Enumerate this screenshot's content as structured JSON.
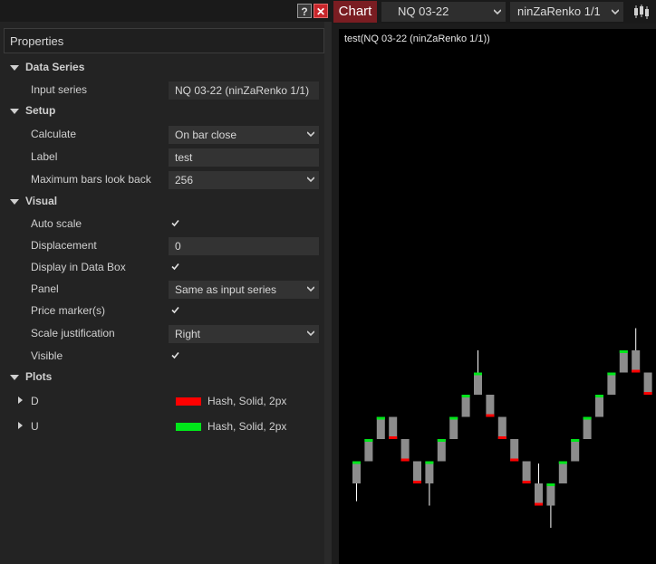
{
  "window": {
    "help_label": "?",
    "close_label": "✕"
  },
  "properties": {
    "title": "Properties",
    "categories": [
      {
        "name": "Data Series"
      },
      {
        "name": "Setup"
      },
      {
        "name": "Visual"
      },
      {
        "name": "Plots"
      }
    ],
    "data_series": {
      "input_series_label": "Input series",
      "input_series_value": "NQ 03-22 (ninZaRenko 1/1)"
    },
    "setup": {
      "calculate_label": "Calculate",
      "calculate_value": "On bar close",
      "label_label": "Label",
      "label_value": "test",
      "max_bars_label": "Maximum bars look back",
      "max_bars_value": "256"
    },
    "visual": {
      "auto_scale_label": "Auto scale",
      "auto_scale_checked": true,
      "displacement_label": "Displacement",
      "displacement_value": "0",
      "data_box_label": "Display in Data Box",
      "data_box_checked": true,
      "panel_label": "Panel",
      "panel_value": "Same as input series",
      "price_marker_label": "Price marker(s)",
      "price_marker_checked": true,
      "scale_just_label": "Scale justification",
      "scale_just_value": "Right",
      "visible_label": "Visible",
      "visible_checked": true
    },
    "plots": [
      {
        "name": "D",
        "color": "#ff0000",
        "desc": "Hash, Solid, 2px"
      },
      {
        "name": "U",
        "color": "#00e61a",
        "desc": "Hash, Solid, 2px"
      }
    ]
  },
  "chart_toolbar": {
    "tab_label": "Chart",
    "instrument": "NQ 03-22",
    "bar_type": "ninZaRenko 1/1"
  },
  "chart": {
    "label": "test(NQ 03-22 (ninZaRenko 1/1))",
    "colors": {
      "body": "#8c8c8c",
      "up_marker": "#00e61a",
      "down_marker": "#ff0000",
      "wick": "#ffffff",
      "background": "#000000"
    },
    "bars": [
      {
        "dir": "up",
        "low": 15,
        "high": 16,
        "wick_low": 14.2
      },
      {
        "dir": "up",
        "low": 16,
        "high": 17
      },
      {
        "dir": "up",
        "low": 17,
        "high": 18
      },
      {
        "dir": "down",
        "low": 17,
        "high": 18
      },
      {
        "dir": "down",
        "low": 16,
        "high": 17
      },
      {
        "dir": "down",
        "low": 15,
        "high": 16
      },
      {
        "dir": "up",
        "low": 15,
        "high": 16,
        "wick_low": 14.0
      },
      {
        "dir": "up",
        "low": 16,
        "high": 17
      },
      {
        "dir": "up",
        "low": 17,
        "high": 18
      },
      {
        "dir": "up",
        "low": 18,
        "high": 19
      },
      {
        "dir": "up",
        "low": 19,
        "high": 20,
        "wick_high": 21.0
      },
      {
        "dir": "down",
        "low": 18,
        "high": 19
      },
      {
        "dir": "down",
        "low": 17,
        "high": 18
      },
      {
        "dir": "down",
        "low": 16,
        "high": 17
      },
      {
        "dir": "down",
        "low": 15,
        "high": 16
      },
      {
        "dir": "down",
        "low": 14,
        "high": 15,
        "wick_high": 15.9
      },
      {
        "dir": "up",
        "low": 14,
        "high": 15,
        "wick_low": 13.0
      },
      {
        "dir": "up",
        "low": 15,
        "high": 16
      },
      {
        "dir": "up",
        "low": 16,
        "high": 17
      },
      {
        "dir": "up",
        "low": 17,
        "high": 18
      },
      {
        "dir": "up",
        "low": 18,
        "high": 19
      },
      {
        "dir": "up",
        "low": 19,
        "high": 20
      },
      {
        "dir": "up",
        "low": 20,
        "high": 21
      },
      {
        "dir": "down",
        "low": 20,
        "high": 21,
        "wick_high": 22.0
      },
      {
        "dir": "down",
        "low": 19,
        "high": 20
      },
      {
        "dir": "down",
        "low": 18,
        "high": 19
      },
      {
        "dir": "down",
        "low": 17,
        "high": 18
      }
    ]
  }
}
